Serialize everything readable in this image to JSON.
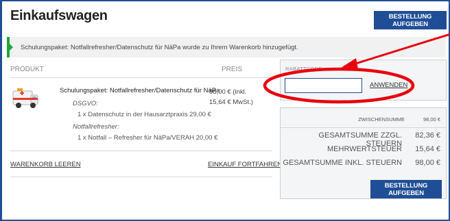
{
  "page_title": "Einkaufswagen",
  "checkout_button_label": "BESTELLUNG AUFGEBEN",
  "notice_text": "Schulungspaket: Notfallrefresher/Datenschutz für NäPa wurde zu Ihrem Warenkorb hinzugefügt.",
  "table": {
    "col_product": "PRODUKT",
    "col_price": "PREIS"
  },
  "cart_item": {
    "title": "Schulungspaket: Notfallrefresher/Datenschutz für NäPa",
    "option1_label": "DSGVO:",
    "option1_value": "1 x Datenschutz in der Hausarztpraxis 29,00 €",
    "option2_label": "Notfallrefresher:",
    "option2_value": "1 x Notfall – Refresher für NäPa/VERAH 20,00 €",
    "price_line1": "98,00 € (inkl.",
    "price_line2": "15,64 € MwSt.)"
  },
  "links": {
    "clear_cart": "WARENKORB LEEREN",
    "continue_shopping": "EINKAUF FORTFAHREN"
  },
  "coupon": {
    "label": "RABATTCODE",
    "input_value": "",
    "apply_label": "ANWENDEN"
  },
  "totals": {
    "subtotal_label": "ZWISCHENSUMME",
    "subtotal_value": "98,00 €",
    "total_excl_label": "GESAMTSUMME ZZGL. STEUERN",
    "total_excl_value": "82,36 €",
    "vat_label": "MEHRWERTSTEUER",
    "vat_value": "15,64 €",
    "total_incl_label": "GESAMTSUMME INKL. STEUERN",
    "total_incl_value": "98,00 €"
  },
  "colors": {
    "accent": "#1f4e96",
    "success": "#1fa63a",
    "annotation": "#e8000d"
  },
  "icons": {
    "product_thumbnail": "ambulance-icon",
    "notice_marker": "success-arrow-icon"
  }
}
